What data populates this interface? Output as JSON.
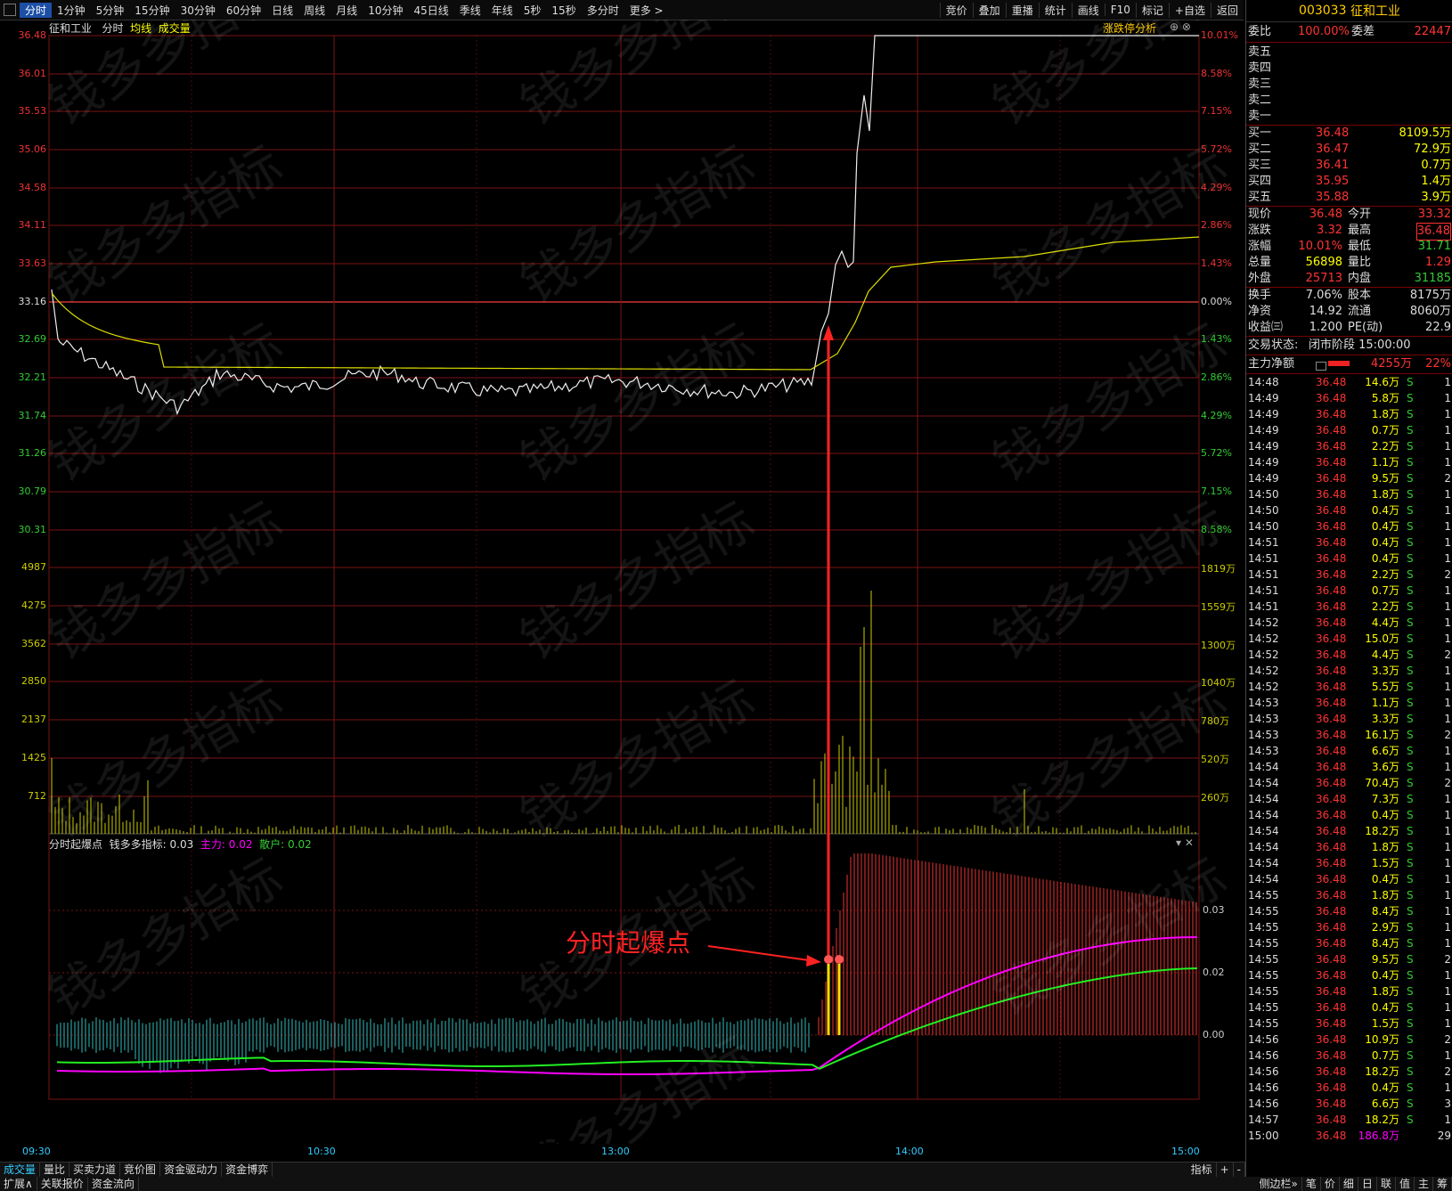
{
  "toolbar": {
    "tabs": [
      "分时",
      "1分钟",
      "5分钟",
      "15分钟",
      "30分钟",
      "60分钟",
      "日线",
      "周线",
      "月线",
      "10分钟",
      "45日线",
      "季线",
      "年线",
      "5秒",
      "15秒",
      "多分时",
      "更多 >"
    ],
    "right": [
      "竞价",
      "叠加",
      "重播",
      "统计",
      "画线",
      "F10",
      "标记",
      "+自选",
      "返回"
    ]
  },
  "chart_header": {
    "stock": "征和工业",
    "mode": "分时",
    "avg": "均线",
    "vol": "成交量",
    "analysis": "涨跌停分析"
  },
  "price_axis_left": [
    "36.48",
    "36.01",
    "35.53",
    "35.06",
    "34.58",
    "34.11",
    "33.63",
    "33.16",
    "32.69",
    "32.21",
    "31.74",
    "31.26",
    "30.79",
    "30.31"
  ],
  "pct_axis_right": [
    "10.01%",
    "8.58%",
    "7.15%",
    "5.72%",
    "4.29%",
    "2.86%",
    "1.43%",
    "0.00%",
    "1.43%",
    "2.86%",
    "4.29%",
    "5.72%",
    "7.15%",
    "8.58%"
  ],
  "vol_axis_left": [
    "4987",
    "4275",
    "3562",
    "2850",
    "2137",
    "1425",
    "712"
  ],
  "vol_axis_right": [
    "1819万",
    "1559万",
    "1300万",
    "1040万",
    "780万",
    "520万",
    "260万"
  ],
  "indicator": {
    "name": "分时起爆点",
    "label": "钱多多指标:",
    "value": "0.03",
    "main_label": "主力:",
    "main_value": "0.02",
    "retail_label": "散户:",
    "retail_value": "0.02",
    "axis": [
      "0.03",
      "0.02",
      "0.00"
    ]
  },
  "annotation": "分时起爆点",
  "watermark": "钱多多指标",
  "time_axis": [
    "09:30",
    "10:30",
    "13:00",
    "14:00",
    "15:00"
  ],
  "bottom_tabs": [
    "成交量",
    "量比",
    "买卖力道",
    "竞价图",
    "资金驱动力",
    "资金博弈"
  ],
  "bottom_right": [
    "指标",
    "+",
    "-"
  ],
  "bottom2": [
    "扩展∧",
    "关联报价",
    "资金流向"
  ],
  "sidebar_bottom": [
    "侧边栏»",
    "笔",
    "价",
    "细",
    "日",
    "联",
    "值",
    "主",
    "筹"
  ],
  "sidebar": {
    "code": "003033",
    "name": "征和工业",
    "weibi_label": "委比",
    "weibi": "100.00%",
    "weicha_label": "委差",
    "weicha": "22447",
    "sells": [
      "卖五",
      "卖四",
      "卖三",
      "卖二",
      "卖一"
    ],
    "buys": [
      {
        "label": "买一",
        "price": "36.48",
        "vol": "8109.5万"
      },
      {
        "label": "买二",
        "price": "36.47",
        "vol": "72.9万"
      },
      {
        "label": "买三",
        "price": "36.41",
        "vol": "0.7万"
      },
      {
        "label": "买四",
        "price": "35.95",
        "vol": "1.4万"
      },
      {
        "label": "买五",
        "price": "35.88",
        "vol": "3.9万"
      }
    ],
    "stats": [
      {
        "l1": "现价",
        "v1": "36.48",
        "l2": "今开",
        "v2": "33.32"
      },
      {
        "l1": "涨跌",
        "v1": "3.32",
        "l2": "最高",
        "v2": "36.48"
      },
      {
        "l1": "涨幅",
        "v1": "10.01%",
        "l2": "最低",
        "v2": "31.71"
      },
      {
        "l1": "总量",
        "v1": "56898",
        "l2": "量比",
        "v2": "1.29"
      },
      {
        "l1": "外盘",
        "v1": "25713",
        "l2": "内盘",
        "v2": "31185"
      },
      {
        "l1": "换手",
        "v1": "7.06%",
        "l2": "股本",
        "v2": "8175万"
      },
      {
        "l1": "净资",
        "v1": "14.92",
        "l2": "流通",
        "v2": "8060万"
      },
      {
        "l1": "收益㈢",
        "v1": "1.200",
        "l2": "PE(动)",
        "v2": "22.9"
      }
    ],
    "status_label": "交易状态:",
    "status": "闭市阶段 15:00:00",
    "mainflow_label": "主力净额",
    "mainflow": "4255万",
    "mainflow_pct": "22%",
    "trades": [
      [
        "14:48",
        "36.48",
        "14.6万",
        "S",
        "1"
      ],
      [
        "14:49",
        "36.48",
        "5.8万",
        "S",
        "1"
      ],
      [
        "14:49",
        "36.48",
        "1.8万",
        "S",
        "1"
      ],
      [
        "14:49",
        "36.48",
        "0.7万",
        "S",
        "1"
      ],
      [
        "14:49",
        "36.48",
        "2.2万",
        "S",
        "1"
      ],
      [
        "14:49",
        "36.48",
        "1.1万",
        "S",
        "1"
      ],
      [
        "14:49",
        "36.48",
        "9.5万",
        "S",
        "2"
      ],
      [
        "14:50",
        "36.48",
        "1.8万",
        "S",
        "1"
      ],
      [
        "14:50",
        "36.48",
        "0.4万",
        "S",
        "1"
      ],
      [
        "14:50",
        "36.48",
        "0.4万",
        "S",
        "1"
      ],
      [
        "14:51",
        "36.48",
        "0.4万",
        "S",
        "1"
      ],
      [
        "14:51",
        "36.48",
        "0.4万",
        "S",
        "1"
      ],
      [
        "14:51",
        "36.48",
        "2.2万",
        "S",
        "2"
      ],
      [
        "14:51",
        "36.48",
        "0.7万",
        "S",
        "1"
      ],
      [
        "14:51",
        "36.48",
        "2.2万",
        "S",
        "1"
      ],
      [
        "14:52",
        "36.48",
        "4.4万",
        "S",
        "1"
      ],
      [
        "14:52",
        "36.48",
        "15.0万",
        "S",
        "1"
      ],
      [
        "14:52",
        "36.48",
        "4.4万",
        "S",
        "2"
      ],
      [
        "14:52",
        "36.48",
        "3.3万",
        "S",
        "1"
      ],
      [
        "14:52",
        "36.48",
        "5.5万",
        "S",
        "1"
      ],
      [
        "14:53",
        "36.48",
        "1.1万",
        "S",
        "1"
      ],
      [
        "14:53",
        "36.48",
        "3.3万",
        "S",
        "1"
      ],
      [
        "14:53",
        "36.48",
        "16.1万",
        "S",
        "2"
      ],
      [
        "14:53",
        "36.48",
        "6.6万",
        "S",
        "1"
      ],
      [
        "14:54",
        "36.48",
        "3.6万",
        "S",
        "1"
      ],
      [
        "14:54",
        "36.48",
        "70.4万",
        "S",
        "2"
      ],
      [
        "14:54",
        "36.48",
        "7.3万",
        "S",
        "1"
      ],
      [
        "14:54",
        "36.48",
        "0.4万",
        "S",
        "1"
      ],
      [
        "14:54",
        "36.48",
        "18.2万",
        "S",
        "1"
      ],
      [
        "14:54",
        "36.48",
        "1.8万",
        "S",
        "1"
      ],
      [
        "14:54",
        "36.48",
        "1.5万",
        "S",
        "1"
      ],
      [
        "14:54",
        "36.48",
        "0.4万",
        "S",
        "1"
      ],
      [
        "14:55",
        "36.48",
        "1.8万",
        "S",
        "1"
      ],
      [
        "14:55",
        "36.48",
        "8.4万",
        "S",
        "1"
      ],
      [
        "14:55",
        "36.48",
        "2.9万",
        "S",
        "1"
      ],
      [
        "14:55",
        "36.48",
        "8.4万",
        "S",
        "1"
      ],
      [
        "14:55",
        "36.48",
        "9.5万",
        "S",
        "2"
      ],
      [
        "14:55",
        "36.48",
        "0.4万",
        "S",
        "1"
      ],
      [
        "14:55",
        "36.48",
        "1.8万",
        "S",
        "1"
      ],
      [
        "14:55",
        "36.48",
        "0.4万",
        "S",
        "1"
      ],
      [
        "14:55",
        "36.48",
        "1.5万",
        "S",
        "1"
      ],
      [
        "14:56",
        "36.48",
        "10.9万",
        "S",
        "2"
      ],
      [
        "14:56",
        "36.48",
        "0.7万",
        "S",
        "1"
      ],
      [
        "14:56",
        "36.48",
        "18.2万",
        "S",
        "2"
      ],
      [
        "14:56",
        "36.48",
        "0.4万",
        "S",
        "1"
      ],
      [
        "14:56",
        "36.48",
        "6.6万",
        "S",
        "3"
      ],
      [
        "14:57",
        "36.48",
        "18.2万",
        "S",
        "1"
      ],
      [
        "15:00",
        "36.48",
        "186.8万",
        "",
        "29"
      ]
    ]
  }
}
